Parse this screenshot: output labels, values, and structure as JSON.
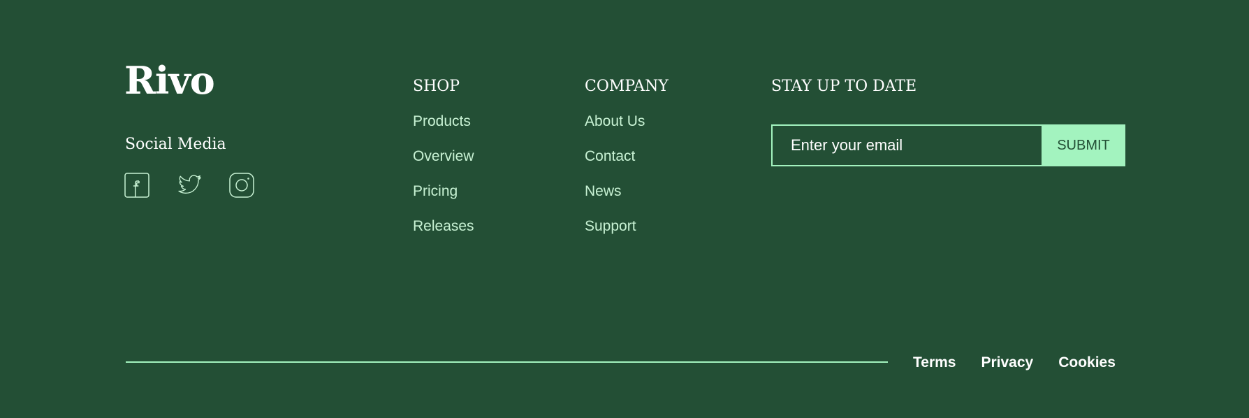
{
  "brand": {
    "logo_text": "Rivo"
  },
  "social": {
    "title": "Social Media",
    "icons": [
      "facebook-icon",
      "twitter-icon",
      "instagram-icon"
    ]
  },
  "shop": {
    "heading": "SHOP",
    "links": [
      "Products",
      "Overview",
      "Pricing",
      "Releases"
    ]
  },
  "company": {
    "heading": "COMPANY",
    "links": [
      "About Us",
      "Contact",
      "News",
      "Support"
    ]
  },
  "newsletter": {
    "heading": "STAY UP TO DATE",
    "email_placeholder": "Enter your email",
    "submit_label": "SUBMIT"
  },
  "legal": {
    "links": [
      "Terms",
      "Privacy",
      "Cookies"
    ]
  },
  "colors": {
    "background": "#234F35",
    "accent": "#A3F3BF",
    "link": "#C8F2D4",
    "text": "#FFFFFF"
  }
}
